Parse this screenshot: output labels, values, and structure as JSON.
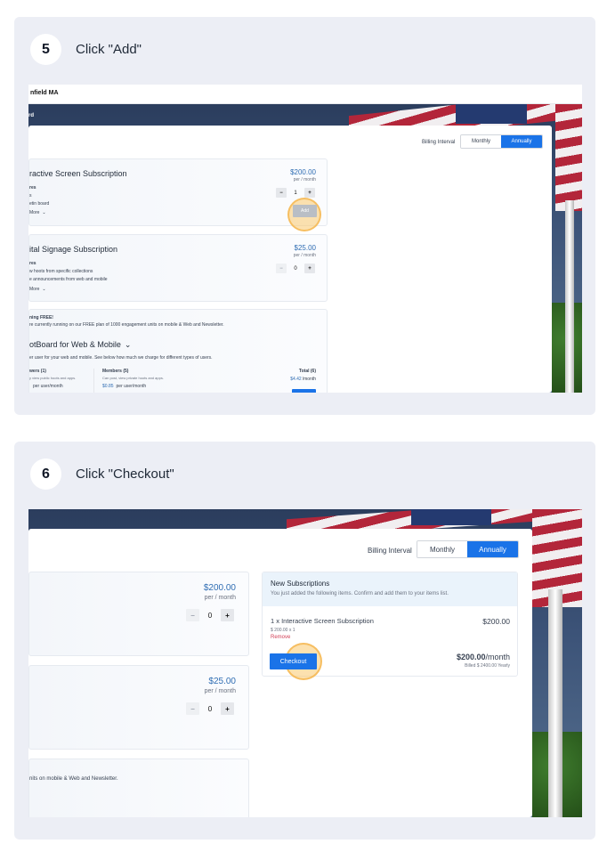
{
  "steps": [
    {
      "number": "5",
      "instruction": "Click \"Add\"",
      "screenshot": {
        "org_name": "nfield MA",
        "side_label": "rd",
        "billing": {
          "label": "Billing Interval",
          "monthly": "Monthly",
          "annually": "Annually",
          "selected": "Annually"
        },
        "plans": [
          {
            "name": "ractive Screen Subscription",
            "price": "$200.00",
            "per": "per / month",
            "lines": [
              "res",
              "s",
              "etin board"
            ],
            "more": "More",
            "qty": "1",
            "add_label": "Add"
          },
          {
            "name": "ital Signage Subscription",
            "price": "$25.00",
            "per": "per / month",
            "lines": [
              "res",
              "w hoots from specific collections",
              "e announcements from web and mobile"
            ],
            "more": "More",
            "qty": "0"
          }
        ],
        "free_plan": {
          "heading": "ning FREE!",
          "note": "re currently running on our FREE plan of 1000 engagement units on mobile & Web and Newsletter.",
          "product": "otBoard for Web & Mobile",
          "desc": "er user for your web and mobile. See below how much we charge for different types of users.",
          "viewers_label": "wers (1)",
          "viewers_desc": "y view public hoots and apps.",
          "viewers_price": "per user/month",
          "members_label": "Members (5)",
          "members_desc": "Can post, view private hoots and apps.",
          "members_price_value": "$0.85",
          "members_price_unit": "per user/month",
          "total_label": "Total (6)",
          "total_value": "$4.42",
          "total_unit": "/month"
        }
      }
    },
    {
      "number": "6",
      "instruction": "Click \"Checkout\"",
      "screenshot": {
        "billing": {
          "label": "Billing Interval",
          "monthly": "Monthly",
          "annually": "Annually",
          "selected": "Annually"
        },
        "plans": [
          {
            "price": "$200.00",
            "per": "per / month",
            "qty": "0"
          },
          {
            "price": "$25.00",
            "per": "per / month",
            "qty": "0"
          }
        ],
        "free_note": "nits on mobile & Web and Newsletter.",
        "new_subscriptions": {
          "title": "New Subscriptions",
          "subtitle": "You just added the following items. Confirm and add them to your items list.",
          "item_name": "1 x Interactive Screen Subscription",
          "item_price": "$200.00",
          "item_detail": "$ 200.00 x 1",
          "remove": "Remove",
          "checkout": "Checkout",
          "total_value": "$200.00",
          "total_unit": "/month",
          "billed": "Billed $ 2400.00 Yearly"
        }
      }
    }
  ],
  "icons": {
    "minus": "−",
    "plus": "+",
    "chevron_down": "⌄"
  }
}
